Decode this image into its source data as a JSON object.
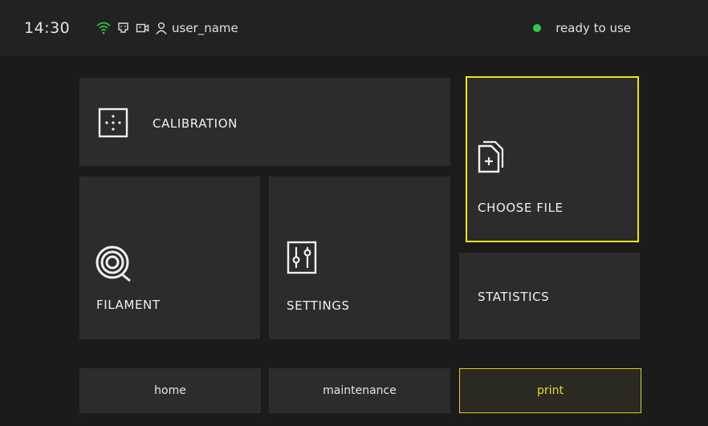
{
  "status_bar": {
    "time": "14:30",
    "user_name": "user_name",
    "status_text": "ready to use",
    "status_color": "#2fc84a",
    "icons": [
      "wifi-icon",
      "network-icon",
      "camera-icon",
      "user-icon"
    ]
  },
  "tiles": {
    "calibration": {
      "label": "CALIBRATION",
      "icon": "calibration-icon"
    },
    "filament": {
      "label": "FILAMENT",
      "icon": "filament-spool-icon"
    },
    "settings": {
      "label": "SETTINGS",
      "icon": "sliders-icon"
    },
    "choose_file": {
      "label": "CHOOSE FILE",
      "icon": "add-file-icon",
      "highlight_color": "#f0e21c"
    },
    "statistics": {
      "label": "STATISTICS"
    }
  },
  "nav": {
    "home": "home",
    "maintenance": "maintenance",
    "print": "print",
    "active": "print",
    "active_color": "#e8de1c"
  }
}
